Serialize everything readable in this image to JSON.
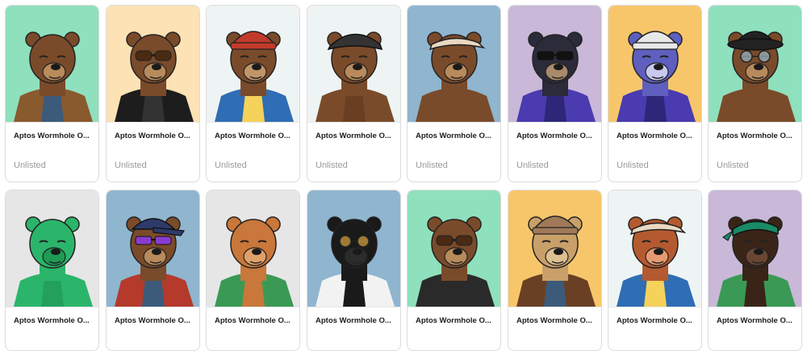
{
  "cards": [
    {
      "title": "Aptos Wormhole O...",
      "status": "Unlisted",
      "bg": "#8fe0bd",
      "fur": "#7a4b2a",
      "muzzle": "#b88a5c",
      "outfit": "#8a5a2f",
      "inner": "#3c5a7a",
      "hat": "none",
      "hat_color": "",
      "eyewear": "none",
      "eye_color": ""
    },
    {
      "title": "Aptos Wormhole O...",
      "status": "Unlisted",
      "bg": "#fce2b4",
      "fur": "#7a4b2a",
      "muzzle": "#b88a5c",
      "outfit": "#1d1d1d",
      "inner": "#333333",
      "hat": "none",
      "hat_color": "",
      "eyewear": "goggles",
      "eye_color": "#4a2a12"
    },
    {
      "title": "Aptos Wormhole O...",
      "status": "Unlisted",
      "bg": "#eef4f3",
      "fur": "#7a4b2a",
      "muzzle": "#c19568",
      "outfit": "#2f6db5",
      "inner": "#f5d25a",
      "hat": "beanie",
      "hat_color": "#c23a2b",
      "eyewear": "none",
      "eye_color": ""
    },
    {
      "title": "Aptos Wormhole O...",
      "status": "Unlisted",
      "bg": "#eef4f3",
      "fur": "#7a4b2a",
      "muzzle": "#b88a5c",
      "outfit": "#7a4b2a",
      "inner": "#6a3e20",
      "hat": "flatcap",
      "hat_color": "#333333",
      "eyewear": "none",
      "eye_color": ""
    },
    {
      "title": "Aptos Wormhole O...",
      "status": "Unlisted",
      "bg": "#8fb5cf",
      "fur": "#7a4b2a",
      "muzzle": "#b88a5c",
      "outfit": "#7a4b2a",
      "inner": "#7a4b2a",
      "hat": "visor",
      "hat_color": "#e9d9c2",
      "eyewear": "none",
      "eye_color": ""
    },
    {
      "title": "Aptos Wormhole O...",
      "status": "Unlisted",
      "bg": "#c9b8d8",
      "fur": "#2b2b3a",
      "muzzle": "#a98a6a",
      "outfit": "#4a3bb0",
      "inner": "#2e2678",
      "hat": "none",
      "hat_color": "",
      "eyewear": "sunglasses",
      "eye_color": "#111111"
    },
    {
      "title": "Aptos Wormhole O...",
      "status": "Unlisted",
      "bg": "#f8c66a",
      "fur": "#5e5fbe",
      "muzzle": "#c8c9ee",
      "outfit": "#4a3bb0",
      "inner": "#2e2678",
      "hat": "beanie",
      "hat_color": "#e8e8e8",
      "eyewear": "none",
      "eye_color": ""
    },
    {
      "title": "Aptos Wormhole O...",
      "status": "Unlisted",
      "bg": "#8fe0bd",
      "fur": "#7a4b2a",
      "muzzle": "#b88a5c",
      "outfit": "#7a4b2a",
      "inner": "#7a4b2a",
      "hat": "bucket",
      "hat_color": "#222222",
      "eyewear": "round",
      "eye_color": "#9bb8c9"
    },
    {
      "title": "Aptos Wormhole O...",
      "status": "",
      "bg": "#e6e6e6",
      "fur": "#2bb56a",
      "muzzle": "#1f9a55",
      "outfit": "#2bb56a",
      "inner": "#22a05c",
      "hat": "none",
      "hat_color": "",
      "eyewear": "none",
      "eye_color": ""
    },
    {
      "title": "Aptos Wormhole O...",
      "status": "",
      "bg": "#8fb5cf",
      "fur": "#7a4b2a",
      "muzzle": "#b88a5c",
      "outfit": "#b53a2b",
      "inner": "#3c5a7a",
      "hat": "cap",
      "hat_color": "#2e3a6a",
      "eyewear": "sunglasses",
      "eye_color": "#8a3bd0"
    },
    {
      "title": "Aptos Wormhole O...",
      "status": "",
      "bg": "#e6e6e6",
      "fur": "#c9773a",
      "muzzle": "#e0a06a",
      "outfit": "#3a9a55",
      "inner": "#c9773a",
      "hat": "none",
      "hat_color": "",
      "eyewear": "none",
      "eye_color": ""
    },
    {
      "title": "Aptos Wormhole O...",
      "status": "",
      "bg": "#8fb5cf",
      "fur": "#1a1a1a",
      "muzzle": "#2c2c2c",
      "outfit": "#f2f2f2",
      "inner": "#1a1a1a",
      "hat": "none",
      "hat_color": "",
      "eyewear": "round",
      "eye_color": "#d9a441"
    },
    {
      "title": "Aptos Wormhole O...",
      "status": "",
      "bg": "#8fe0bd",
      "fur": "#7a4b2a",
      "muzzle": "#b88a5c",
      "outfit": "#2a2a2a",
      "inner": "#2a2a2a",
      "hat": "none",
      "hat_color": "",
      "eyewear": "goggles",
      "eye_color": "#4a2a12"
    },
    {
      "title": "Aptos Wormhole O...",
      "status": "",
      "bg": "#f8c66a",
      "fur": "#c9a06a",
      "muzzle": "#dcc08f",
      "outfit": "#6a4024",
      "inner": "#3c5a7a",
      "hat": "beanie",
      "hat_color": "#a07a58",
      "eyewear": "none",
      "eye_color": ""
    },
    {
      "title": "Aptos Wormhole O...",
      "status": "",
      "bg": "#eef4f3",
      "fur": "#b55a30",
      "muzzle": "#e59a70",
      "outfit": "#2f6db5",
      "inner": "#f5d25a",
      "hat": "visor",
      "hat_color": "#e9d9c2",
      "eyewear": "none",
      "eye_color": ""
    },
    {
      "title": "Aptos Wormhole O...",
      "status": "",
      "bg": "#c9b8d8",
      "fur": "#3a2418",
      "muzzle": "#6a4632",
      "outfit": "#3a9a55",
      "inner": "#3a2418",
      "hat": "bandana",
      "hat_color": "#1a8a66",
      "eyewear": "none",
      "eye_color": ""
    }
  ]
}
